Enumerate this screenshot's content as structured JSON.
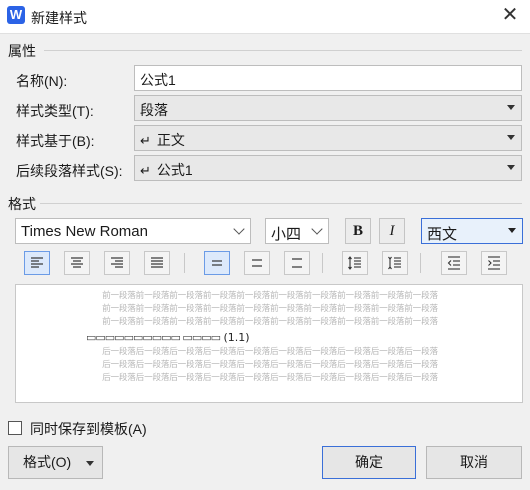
{
  "window": {
    "title": "新建样式",
    "app_logo": "W"
  },
  "sections": {
    "properties": "属性",
    "format": "格式"
  },
  "properties": {
    "name_label": "名称(N):",
    "name_value": "公式1",
    "type_label": "样式类型(T):",
    "type_value": "段落",
    "based_on_label": "样式基于(B):",
    "based_on_value": "正文",
    "next_label": "后续段落样式(S):",
    "next_value": "公式1",
    "enter_glyph": "↵"
  },
  "format": {
    "font": "Times New Roman",
    "size": "小四",
    "bold": "B",
    "italic": "I",
    "script": "西文"
  },
  "preview": {
    "prev_line": "前一段落前一段落前一段落前一段落前一段落前一段落前一段落前一段落前一段落前一段落",
    "main_glyphs": "▭▭▭▭▭▭▭▭▭▭ ▭▭▭▭",
    "main_number": "(1.1)",
    "next_line": "后一段落后一段落后一段落后一段落后一段落后一段落后一段落后一段落后一段落后一段落"
  },
  "options": {
    "save_to_template": "同时保存到模板(A)"
  },
  "buttons": {
    "format": "格式(O)",
    "ok": "确定",
    "cancel": "取消"
  },
  "colors": {
    "accent": "#3a6fd8",
    "logo": "#2b63e6"
  },
  "icons": {
    "align": [
      "align-left-icon",
      "align-center-icon",
      "align-right-icon",
      "justify-icon"
    ],
    "spacing": [
      "line-spacing-single-icon",
      "line-spacing-1-5-icon",
      "line-spacing-double-icon"
    ],
    "paragraph": [
      "para-spacing-increase-icon",
      "para-spacing-decrease-icon",
      "indent-decrease-icon",
      "indent-increase-icon"
    ]
  }
}
